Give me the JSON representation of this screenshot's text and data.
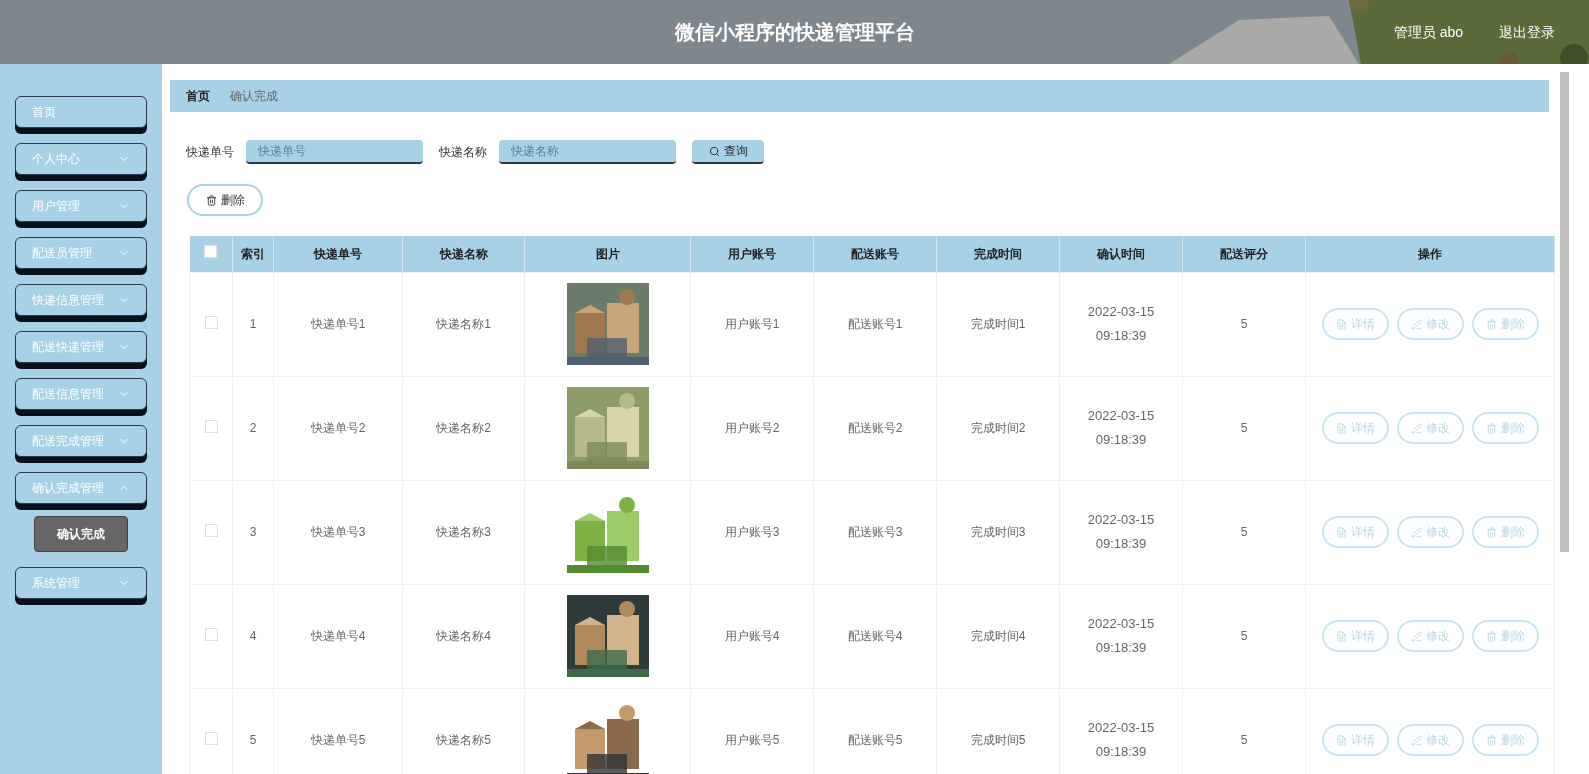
{
  "header": {
    "title": "微信小程序的快递管理平台",
    "user": "管理员 abo",
    "logout": "退出登录"
  },
  "sidebar": {
    "items": [
      {
        "label": "首页",
        "kind": "link"
      },
      {
        "label": "个人中心",
        "kind": "menu",
        "expanded": false
      },
      {
        "label": "用户管理",
        "kind": "menu",
        "expanded": false
      },
      {
        "label": "配送员管理",
        "kind": "menu",
        "expanded": false
      },
      {
        "label": "快递信息管理",
        "kind": "menu",
        "expanded": false
      },
      {
        "label": "配送快递管理",
        "kind": "menu",
        "expanded": false
      },
      {
        "label": "配送信息管理",
        "kind": "menu",
        "expanded": false
      },
      {
        "label": "配送完成管理",
        "kind": "menu",
        "expanded": false
      },
      {
        "label": "确认完成管理",
        "kind": "menu",
        "expanded": true,
        "children": [
          {
            "label": "确认完成",
            "selected": true
          }
        ]
      },
      {
        "label": "系统管理",
        "kind": "menu",
        "expanded": false
      }
    ]
  },
  "breadcrumb": [
    "首页",
    "确认完成"
  ],
  "search": {
    "fields": [
      {
        "label": "快递单号",
        "placeholder": "快递单号"
      },
      {
        "label": "快递名称",
        "placeholder": "快递名称"
      }
    ],
    "button": "查询"
  },
  "toolbar": {
    "delete": "删除"
  },
  "table": {
    "select_all": {
      "checked": false
    },
    "columns": [
      "索引",
      "快递单号",
      "快递名称",
      "图片",
      "用户账号",
      "配送账号",
      "完成时间",
      "确认时间",
      "配送评分",
      "操作"
    ],
    "rows": [
      {
        "checked": false,
        "index": "1",
        "code": "快递单号1",
        "name": "快递名称1",
        "user": "用户账号1",
        "courier": "配送账号1",
        "done": "完成时间1",
        "confirmed": "2022-03-15 09:18:39",
        "score": "5",
        "actions": [
          "详情",
          "修改",
          "删除"
        ]
      },
      {
        "checked": false,
        "index": "2",
        "code": "快递单号2",
        "name": "快递名称2",
        "user": "用户账号2",
        "courier": "配送账号2",
        "done": "完成时间2",
        "confirmed": "2022-03-15 09:18:39",
        "score": "5",
        "actions": [
          "详情",
          "修改",
          "删除"
        ]
      },
      {
        "checked": false,
        "index": "3",
        "code": "快递单号3",
        "name": "快递名称3",
        "user": "用户账号3",
        "courier": "配送账号3",
        "done": "完成时间3",
        "confirmed": "2022-03-15 09:18:39",
        "score": "5",
        "actions": [
          "详情",
          "修改",
          "删除"
        ]
      },
      {
        "checked": false,
        "index": "4",
        "code": "快递单号4",
        "name": "快递名称4",
        "user": "用户账号4",
        "courier": "配送账号4",
        "done": "完成时间4",
        "confirmed": "2022-03-15 09:18:39",
        "score": "5",
        "actions": [
          "详情",
          "修改",
          "删除"
        ]
      },
      {
        "checked": false,
        "index": "5",
        "code": "快递单号5",
        "name": "快递名称5",
        "user": "用户账号5",
        "courier": "配送账号5",
        "done": "完成时间5",
        "confirmed": "2022-03-15 09:18:39",
        "score": "5",
        "actions": [
          "详情",
          "修改",
          "删除"
        ]
      }
    ]
  }
}
